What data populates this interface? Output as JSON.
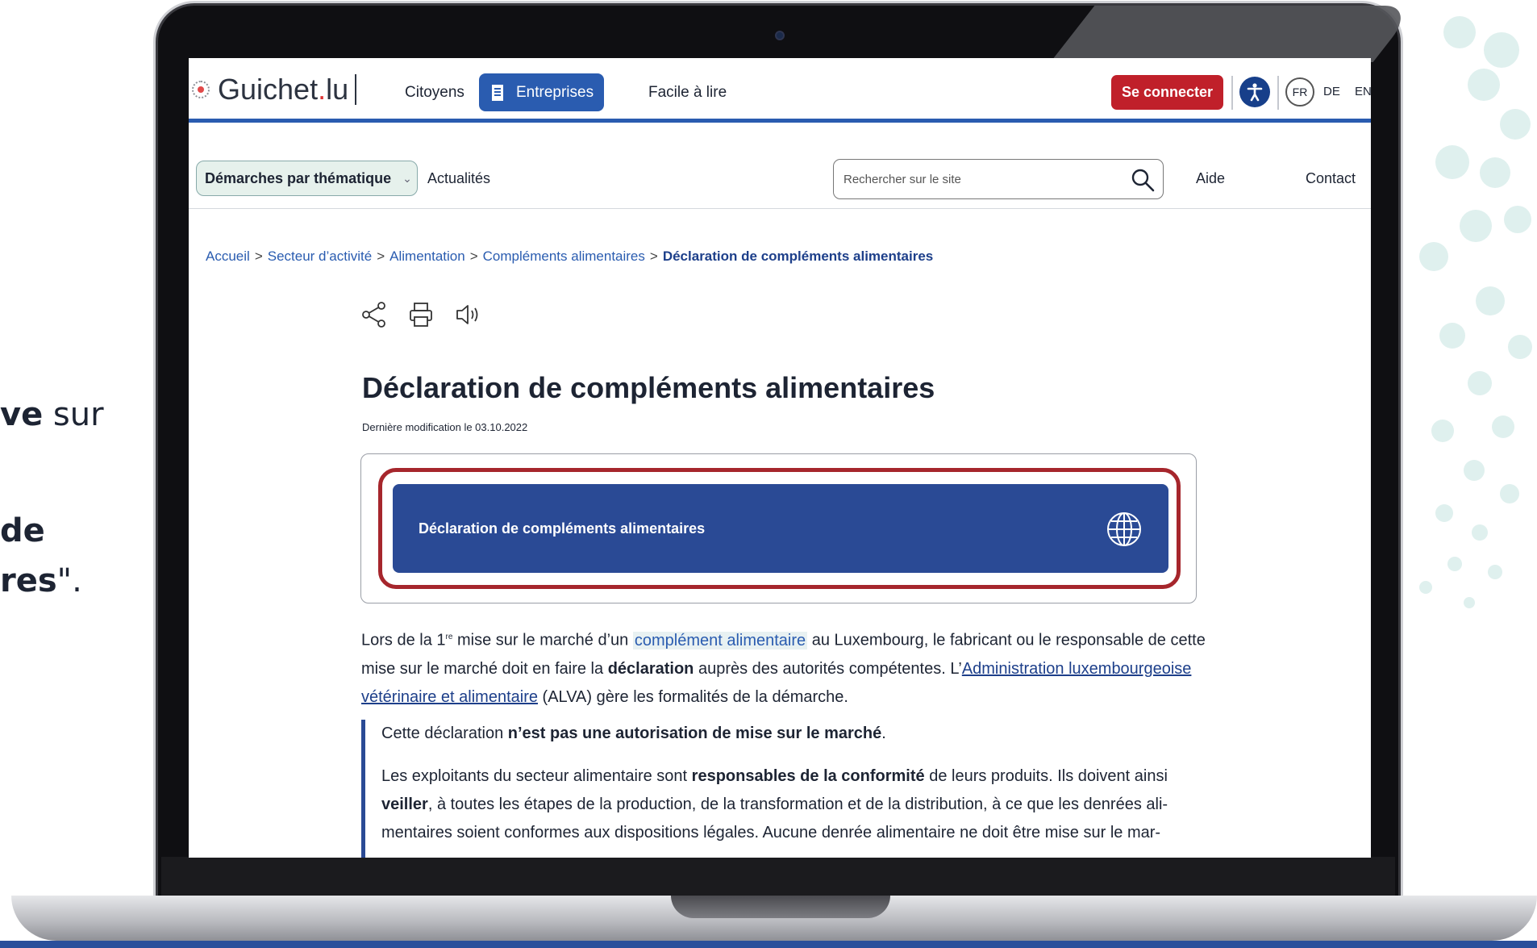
{
  "instructions": {
    "line1_bold": "ve",
    "line1_rest": " sur",
    "line2_bold": "de",
    "line3_bold": "res",
    "line3_rest": "\"."
  },
  "header": {
    "logo_text": "Guichet",
    "logo_dot": ".",
    "logo_tld": "lu",
    "nav": {
      "citoyens": "Citoyens",
      "entreprises": "Entreprises",
      "facile": "Facile à lire"
    },
    "connect_label": "Se connecter",
    "accessibility_icon": "accessibility-icon",
    "languages": {
      "fr": "FR",
      "de": "DE",
      "en": "EN"
    },
    "colors": {
      "brand_blue": "#2a5cb0",
      "connect_red": "#c0202a"
    }
  },
  "subnav": {
    "themes_label": "Démarches par thématique",
    "actualites": "Actualités",
    "search_placeholder": "Rechercher sur le site",
    "aide": "Aide",
    "contact": "Contact"
  },
  "breadcrumb": {
    "items": [
      "Accueil",
      "Secteur d’activité",
      "Alimentation",
      "Compléments alimentaires"
    ],
    "current": "Déclaration de compléments alimentaires",
    "separator": ">"
  },
  "tools": {
    "icons": [
      "share-icon",
      "print-icon",
      "speaker-icon"
    ]
  },
  "article": {
    "title": "Déclaration de compléments alimentaires",
    "last_modified": "Dernière modification le 03.10.2022",
    "card_button_label": "Déclaration de compléments alimentaires",
    "card_icon": "globe-icon",
    "p1_a": "Lors de la 1",
    "p1_sup": "re",
    "p1_b": " mise sur le marché d’un ",
    "p1_link": "complément alimentaire",
    "p1_c": " au Luxembourg, le fabricant ou le responsable de cette mise sur le marché doit en faire la ",
    "p1_bold": "déclaration",
    "p1_d": " auprès des autorités compétentes. L’",
    "p1_link2": "Administration luxem­bourgeoise vétérinaire et alimentaire",
    "p1_e": " (ALVA) gère les formalités de la démarche.",
    "q1_a": "Cette déclaration ",
    "q1_bold": "n’est pas une autorisation de mise sur le marché",
    "q1_b": ".",
    "q2_a": "Les exploitants du secteur alimentaire sont ",
    "q2_bold": "responsables de la conformité",
    "q2_b": " de leurs produits. Ils doivent ainsi ",
    "q2_bold2": "veiller",
    "q2_c": ", à toutes les étapes de la production, de la transformation et de la distribution, à ce que les denrées ali­mentaires soient conformes aux dispositions légales. Aucune denrée alimentaire ne doit être mise sur le mar-"
  }
}
